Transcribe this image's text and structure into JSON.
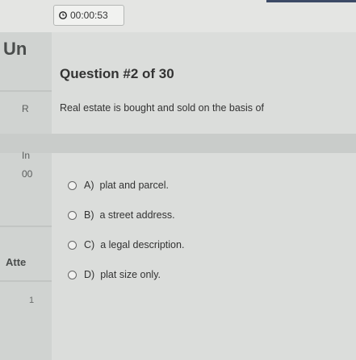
{
  "timer": {
    "icon": "clock-icon",
    "value": "00:00:53"
  },
  "sidebar": {
    "title_fragment": "Un",
    "fragment_r": "R",
    "fragment_in": "In",
    "fragment_00": "00",
    "attempt_fragment": "Atte",
    "fragment_1": "1"
  },
  "question": {
    "header": "Question #2 of 30",
    "text": "Real estate is bought and sold on the basis of"
  },
  "options": [
    {
      "letter": "A)",
      "text": "plat and parcel."
    },
    {
      "letter": "B)",
      "text": "a street address."
    },
    {
      "letter": "C)",
      "text": "a legal description."
    },
    {
      "letter": "D)",
      "text": "plat size only."
    }
  ],
  "colors": {
    "accent": "#3c4a66",
    "background": "#d6d8d6"
  }
}
